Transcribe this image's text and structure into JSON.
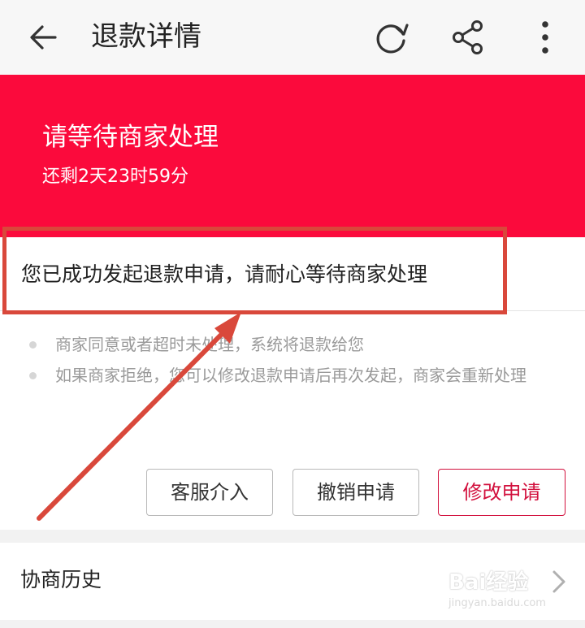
{
  "header": {
    "title": "退款详情",
    "icons": [
      "back-arrow-icon",
      "refresh-icon",
      "share-icon",
      "more-vertical-icon"
    ]
  },
  "banner": {
    "status": "请等待商家处理",
    "countdown": "还剩2天23时59分",
    "color": "#fb0a3c"
  },
  "notice": {
    "message": "您已成功发起退款申请，请耐心等待商家处理"
  },
  "tips": [
    "商家同意或者超时未处理，系统将退款给您",
    "如果商家拒绝，您可以修改退款申请后再次发起，商家会重新处理"
  ],
  "actions": {
    "service_label": "客服介入",
    "cancel_label": "撤销申请",
    "modify_label": "修改申请",
    "accent": "#d2103d"
  },
  "history": {
    "label": "协商历史"
  },
  "annotation": {
    "color": "#d9483b"
  },
  "watermark": {
    "main": "Bai经验",
    "sub": "jingyan.baidu.com"
  }
}
